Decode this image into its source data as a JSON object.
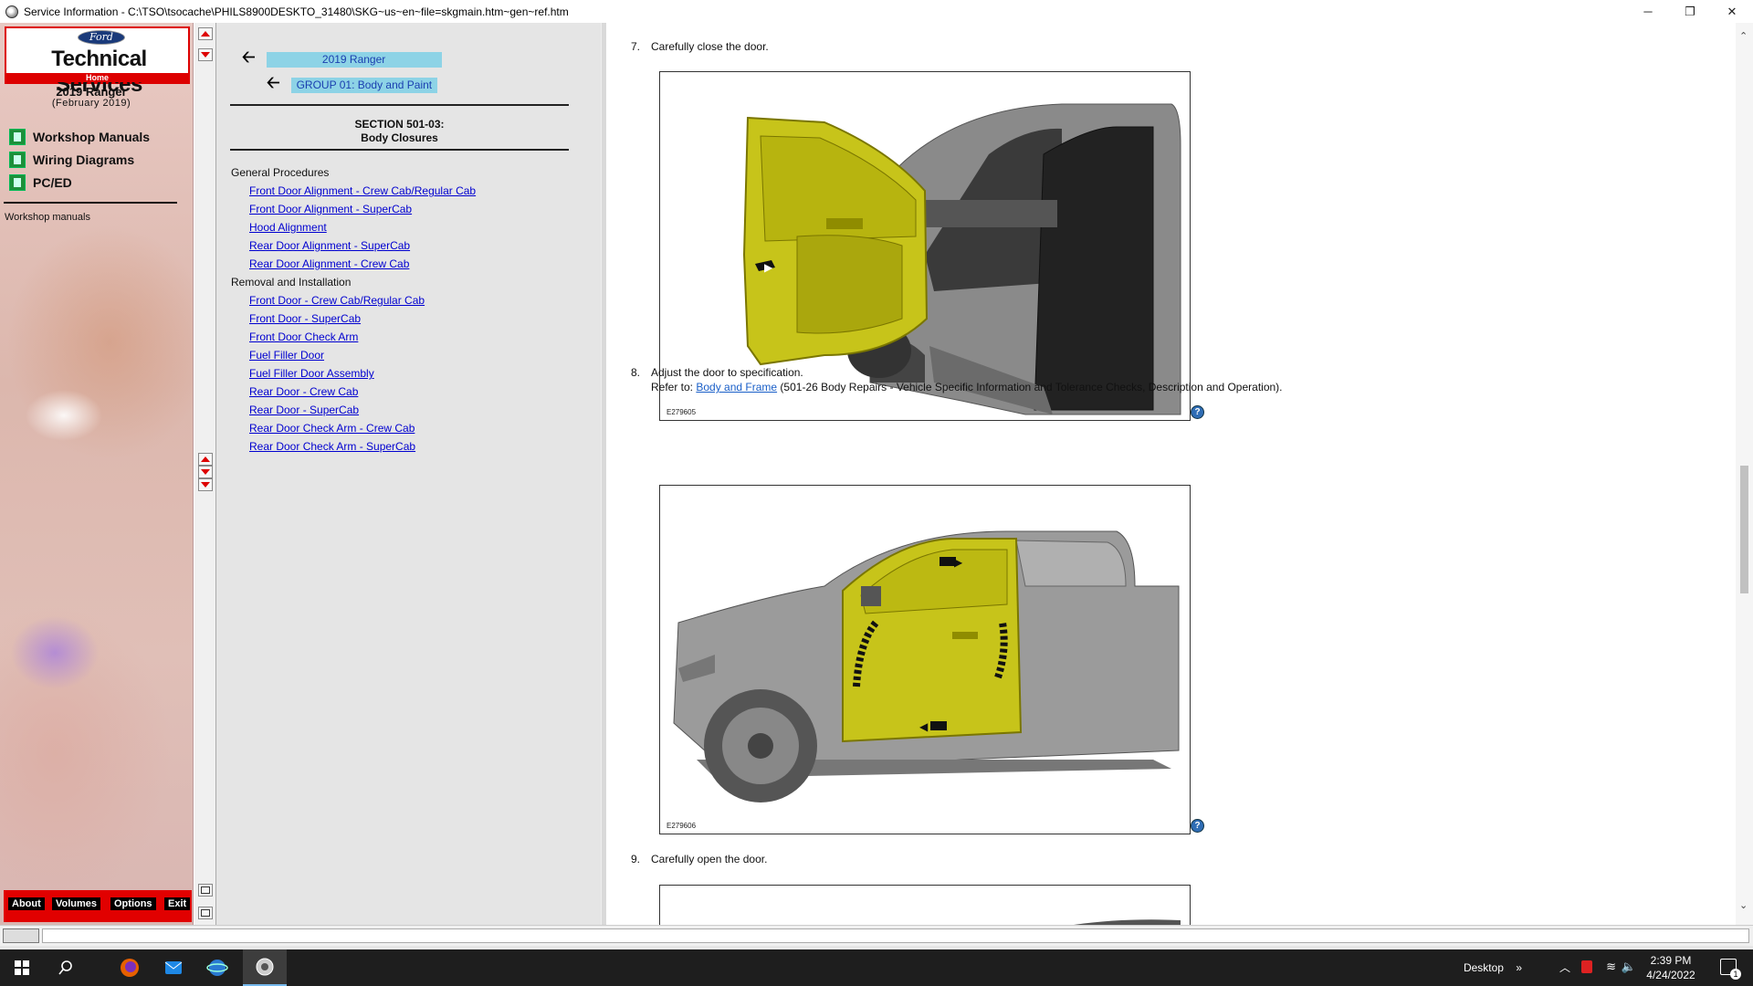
{
  "window": {
    "title": "Service Information - C:\\TSO\\tsocache\\PHILS8900DESKTO_31480\\SKG~us~en~file=skgmain.htm~gen~ref.htm",
    "buttons": {
      "minimize": "─",
      "restore": "❐",
      "close": "✕"
    }
  },
  "left": {
    "brand_logo": "Ford",
    "brand_title": "Technical Services",
    "brand_home": "Home",
    "vehicle": "2019 Ranger",
    "vehicle_date": "(February 2019)",
    "nav": [
      {
        "label": "Workshop Manuals"
      },
      {
        "label": "Wiring Diagrams"
      },
      {
        "label": "PC/ED"
      }
    ],
    "current": "Workshop manuals",
    "buttons": {
      "about": "About",
      "volumes": "Volumes",
      "options": "Options",
      "exit": "Exit"
    }
  },
  "toc": {
    "crumb1": "2019 Ranger",
    "crumb2": "GROUP 01: Body and Paint",
    "section_title": "SECTION 501-03:",
    "section_subtitle": "Body Closures",
    "cat1": "General Procedures",
    "cat1_links": [
      "Front Door Alignment - Crew Cab/Regular Cab",
      "Front Door Alignment - SuperCab",
      "Hood Alignment",
      "Rear Door Alignment - SuperCab",
      "Rear Door Alignment - Crew Cab"
    ],
    "cat2": "Removal and Installation",
    "cat2_links": [
      "Front Door - Crew Cab/Regular Cab",
      "Front Door - SuperCab",
      "Front Door Check Arm",
      "Fuel Filler Door",
      "Fuel Filler Door Assembly",
      "Rear Door - Crew Cab",
      "Rear Door - SuperCab",
      "Rear Door Check Arm - Crew Cab",
      "Rear Door Check Arm - SuperCab"
    ]
  },
  "content": {
    "step7_num": "7.",
    "step7_text": "Carefully close the door.",
    "fig1_caption": "E279605",
    "step8_num": "8.",
    "step8_text": "Adjust the door to specification.",
    "step8_refer": "Refer to:",
    "step8_link": "Body and Frame",
    "step8_rest": " (501-26 Body Repairs - Vehicle Specific Information and Tolerance Checks, Description and Operation).",
    "fig2_caption": "E279606",
    "step9_num": "9.",
    "step9_text": "Carefully open the door.",
    "help_symbol": "?"
  },
  "taskbar": {
    "desktop": "Desktop",
    "time": "2:39 PM",
    "date": "4/24/2022",
    "notif_count": "1"
  },
  "colors": {
    "ford_red": "#e10000",
    "link_blue": "#0000d0",
    "crumb_bg": "#8dd3e6",
    "door_yellow": "#c7c41a"
  },
  "icons": {
    "app": "service-info-icon",
    "nav": "book-icon",
    "help": "help-icon",
    "back": "back-arrow-icon"
  }
}
